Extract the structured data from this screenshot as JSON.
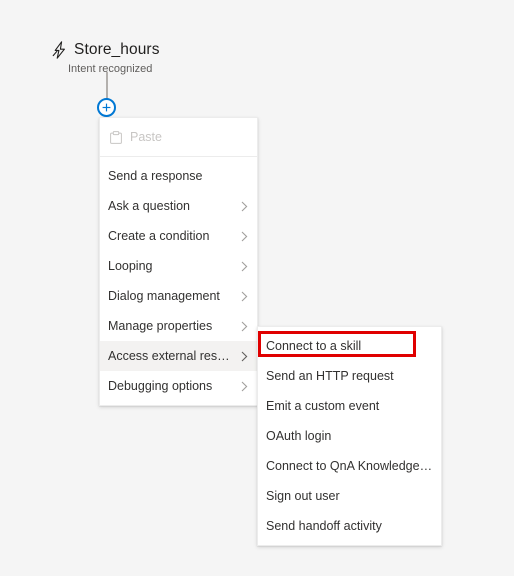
{
  "canvas": {
    "background_color": "#f5f5f5",
    "trigger": {
      "icon": "lightning-bolt-icon",
      "title": "Store_hours",
      "subtitle": "Intent recognized"
    },
    "add_node": {
      "icon": "plus-icon",
      "accent_color": "#0078d4"
    }
  },
  "context_menu": {
    "items": [
      {
        "label": "Paste",
        "icon": "clipboard-paste-icon",
        "disabled": true,
        "submenu": false
      },
      {
        "label": "Send a response",
        "submenu": false
      },
      {
        "label": "Ask a question",
        "submenu": true
      },
      {
        "label": "Create a condition",
        "submenu": true
      },
      {
        "label": "Looping",
        "submenu": true
      },
      {
        "label": "Dialog management",
        "submenu": true
      },
      {
        "label": "Manage properties",
        "submenu": true
      },
      {
        "label": "Access external resources",
        "submenu": true,
        "selected": true
      },
      {
        "label": "Debugging options",
        "submenu": true
      }
    ]
  },
  "submenu": {
    "items": [
      {
        "label": "Connect to a skill",
        "highlighted": true
      },
      {
        "label": "Send an HTTP request"
      },
      {
        "label": "Emit a custom event"
      },
      {
        "label": "OAuth login"
      },
      {
        "label": "Connect to QnA Knowledgebase"
      },
      {
        "label": "Sign out user"
      },
      {
        "label": "Send handoff activity"
      }
    ]
  },
  "annotation": {
    "target": "Connect to a skill",
    "color": "#e00000"
  }
}
